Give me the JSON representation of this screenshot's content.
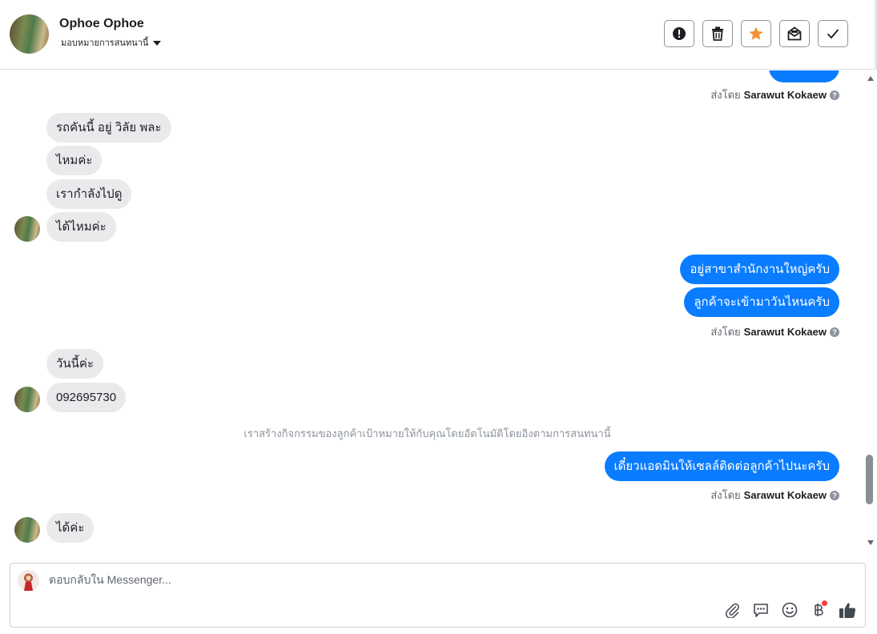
{
  "header": {
    "contact_name": "Ophoe Ophoe",
    "assign_label": "มอบหมายการสนทนานี้"
  },
  "messages": [
    {
      "side": "out",
      "text": "",
      "partial": true
    },
    {
      "side": "in",
      "text": "รถคันนี้ อยู่ วิลัย พละ"
    },
    {
      "side": "in",
      "text": "ไหมค่ะ"
    },
    {
      "side": "in",
      "text": "เรากำลังไปดู"
    },
    {
      "side": "in",
      "text": "ได้ไหมค่ะ"
    },
    {
      "side": "out",
      "text": "อยู่สาขาสำนักงานใหญ่ครับ"
    },
    {
      "side": "out",
      "text": "ลูกค้าจะเข้ามาวันไหนครับ"
    },
    {
      "side": "in",
      "text": "วันนี้ค่ะ"
    },
    {
      "side": "in",
      "text": "092695730"
    },
    {
      "side": "out",
      "text": "เดี๋ยวแอดมินให้เซลล์ติดต่อลูกค้าไปนะครับ"
    },
    {
      "side": "in",
      "text": "ได้ค่ะ"
    }
  ],
  "sent_by_prefix": "ส่งโดย",
  "sent_by_name": "Sarawut Kokaew",
  "system_message": "เราสร้างกิจกรรมของลูกค้าเป้าหมายให้กับคุณโดยอัตโนมัติโดยอิงตามการสนทนานี้",
  "composer": {
    "placeholder": "ตอบกลับใน Messenger..."
  },
  "colors": {
    "outgoing_bubble": "#0a7cff",
    "incoming_bubble": "#e9eaec",
    "star": "#f7923b"
  },
  "icons": [
    "alert-icon",
    "trash-icon",
    "star-icon",
    "mark-unread-icon",
    "check-icon",
    "paperclip-icon",
    "saved-reply-icon",
    "emoji-icon",
    "baht-icon",
    "like-icon"
  ]
}
